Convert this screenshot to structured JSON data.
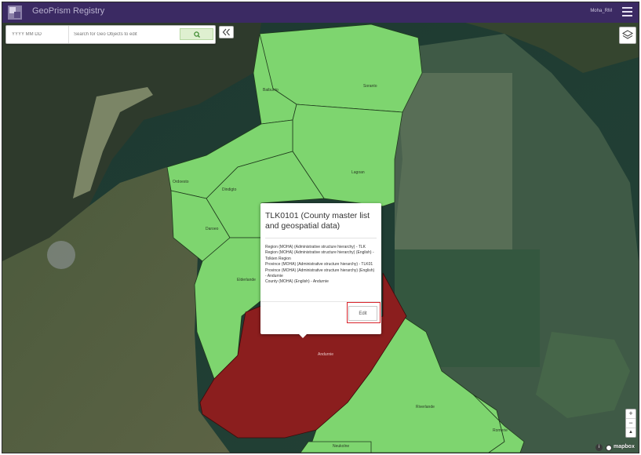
{
  "header": {
    "app_title": "GeoPrism Registry",
    "user_name": "Moha_RM"
  },
  "toolbar": {
    "date_placeholder": "YYYY MM DD",
    "search_placeholder": "Search for Geo Objects to edit",
    "collapse_label": "«"
  },
  "map": {
    "regions": [
      {
        "label": "Soranto",
        "status": "default"
      },
      {
        "label": "Baibunto",
        "status": "default"
      },
      {
        "label": "Lagoan",
        "status": "default"
      },
      {
        "label": "Ordoesto",
        "status": "default"
      },
      {
        "label": "Dindigto",
        "status": "default"
      },
      {
        "label": "Daroeo",
        "status": "default"
      },
      {
        "label": "Elderlande",
        "status": "default"
      },
      {
        "label": "Andurnie",
        "status": "selected"
      },
      {
        "label": "Riverlande",
        "status": "default"
      },
      {
        "label": "Romerie",
        "status": "default"
      },
      {
        "label": "Neukolne",
        "status": "default"
      }
    ],
    "colors": {
      "region_fill": "#7ed56f",
      "region_border": "#1f3a1c",
      "selected_fill": "#8b1e1e",
      "header_bg": "#3b2a63",
      "edit_highlight": "#d8222a"
    },
    "zoom_in": "+",
    "zoom_out": "−",
    "compass": "▲",
    "attribution_icon": "i",
    "brand": "mapbox"
  },
  "popup": {
    "title": "TLK0101 (County master list and geospatial data)",
    "lines": [
      "Region (MOHA) (Administrative structure hierarchy) - TLK",
      "Region (MOHA) (Administrative structure hierarchy) (English) - Tolkien Region",
      "Province (MOHA) (Administrative structure hierarchy) - TLK01",
      "Province (MOHA) (Administrative structure hierarchy) (English) - Andurnie",
      "County (MOHA) (English) - Andurnie"
    ],
    "edit_label": "Edit"
  }
}
